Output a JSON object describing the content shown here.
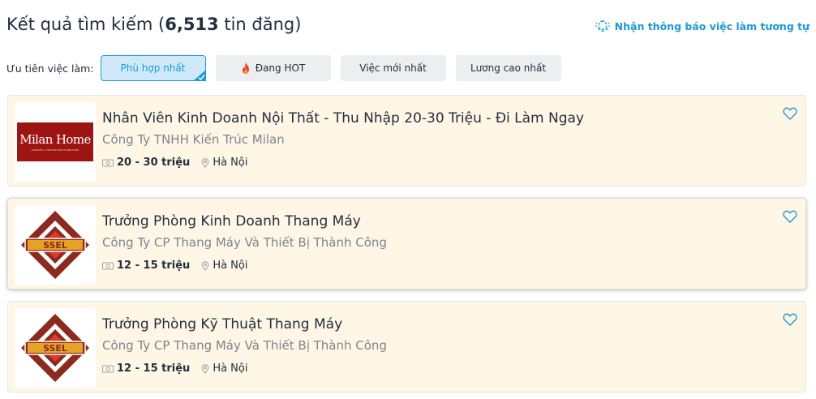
{
  "header": {
    "title_prefix": "Kết quả tìm kiếm (",
    "title_count": "6,513",
    "title_suffix": " tin đăng)",
    "notify_label": "Nhận thông báo việc làm tương tự"
  },
  "filters": {
    "label": "Ưu tiên việc làm:",
    "chips": [
      {
        "label": "Phù hợp nhất",
        "active": true
      },
      {
        "label": "Đang HOT",
        "active": false
      },
      {
        "label": "Việc mới nhất",
        "active": false
      },
      {
        "label": "Lương cao nhất",
        "active": false
      }
    ]
  },
  "jobs": [
    {
      "title": "Nhân Viên Kinh Doanh Nội Thất - Thu Nhập 20-30 Triệu - Đi Làm Ngay",
      "company": "Công Ty TNHH Kiến Trúc Milan",
      "salary": "20 - 30 triệu",
      "location": "Hà Nội",
      "logo": {
        "name": "Milan Home",
        "tagline": "CERAMIC & BATHROOM FURNITURE",
        "color": "#9d1512"
      }
    },
    {
      "title": "Trưởng Phòng Kinh Doanh Thang Máy",
      "company": "Công Ty CP Thang Máy Và Thiết Bị Thành Công",
      "salary": "12 - 15 triệu",
      "location": "Hà Nội",
      "logo": {
        "name": "SSEL",
        "color": "#8c2a1f"
      }
    },
    {
      "title": "Trưởng Phòng Kỹ Thuật Thang Máy",
      "company": "Công Ty CP Thang Máy Và Thiết Bị Thành Công",
      "salary": "12 - 15 triệu",
      "location": "Hà Nội",
      "logo": {
        "name": "SSEL",
        "color": "#8c2a1f"
      }
    }
  ],
  "colors": {
    "accent": "#1d9ad6",
    "card_bg": "#fff6e6",
    "fire": "#e8412c"
  }
}
